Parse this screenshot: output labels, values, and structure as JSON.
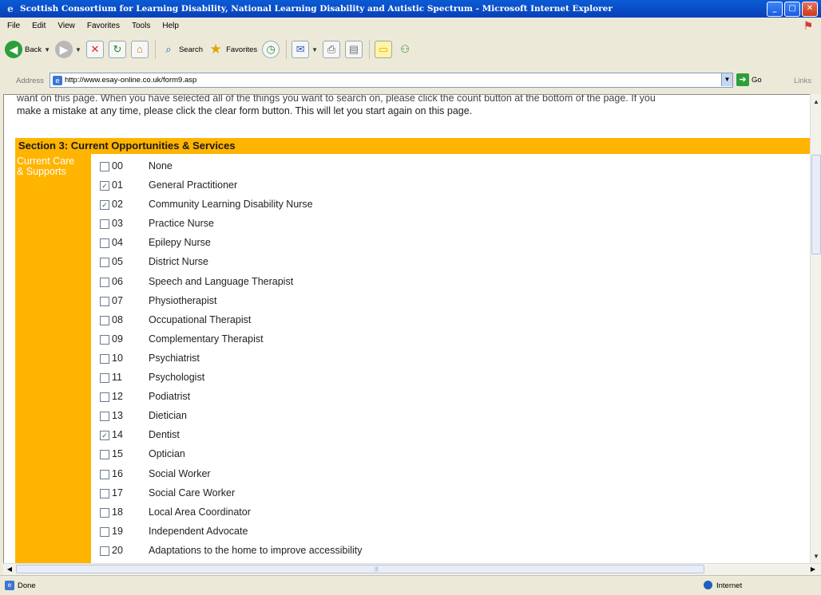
{
  "window": {
    "title": "Scottish Consortium for Learning Disability, National Learning Disability and Autistic Spectrum - Microsoft Internet Explorer"
  },
  "menu": [
    "File",
    "Edit",
    "View",
    "Favorites",
    "Tools",
    "Help"
  ],
  "toolbar": {
    "back_label": "Back",
    "search_label": "Search",
    "favorites_label": "Favorites"
  },
  "address": {
    "label": "Address",
    "url": "http://www.esay-online.co.uk/form9.asp",
    "go_label": "Go",
    "links_label": "Links"
  },
  "page": {
    "intro_line1": "want on this page. When you have selected all of the things you want to search on, please click the count button at the bottom of the page. If you",
    "intro_line2": "make a mistake at any time, please click the clear form button. This will let you start again on this page.",
    "section_title": "Section 3: Current Opportunities & Services",
    "category_line1": "Current Care",
    "category_line2": "& Supports",
    "options": [
      {
        "code": "00",
        "label": "None",
        "checked": false
      },
      {
        "code": "01",
        "label": "General Practitioner",
        "checked": true
      },
      {
        "code": "02",
        "label": "Community Learning Disability Nurse",
        "checked": true
      },
      {
        "code": "03",
        "label": "Practice Nurse",
        "checked": false
      },
      {
        "code": "04",
        "label": "Epilepy Nurse",
        "checked": false
      },
      {
        "code": "05",
        "label": "District Nurse",
        "checked": false
      },
      {
        "code": "06",
        "label": "Speech and Language Therapist",
        "checked": false
      },
      {
        "code": "07",
        "label": "Physiotherapist",
        "checked": false
      },
      {
        "code": "08",
        "label": "Occupational Therapist",
        "checked": false
      },
      {
        "code": "09",
        "label": "Complementary Therapist",
        "checked": false
      },
      {
        "code": "10",
        "label": "Psychiatrist",
        "checked": false
      },
      {
        "code": "11",
        "label": "Psychologist",
        "checked": false
      },
      {
        "code": "12",
        "label": "Podiatrist",
        "checked": false
      },
      {
        "code": "13",
        "label": "Dietician",
        "checked": false
      },
      {
        "code": "14",
        "label": "Dentist",
        "checked": true
      },
      {
        "code": "15",
        "label": "Optician",
        "checked": false
      },
      {
        "code": "16",
        "label": "Social Worker",
        "checked": false
      },
      {
        "code": "17",
        "label": "Social Care Worker",
        "checked": false
      },
      {
        "code": "18",
        "label": "Local Area Coordinator",
        "checked": false
      },
      {
        "code": "19",
        "label": "Independent Advocate",
        "checked": false
      },
      {
        "code": "20",
        "label": "Adaptations to the home to improve accessibility",
        "checked": false
      }
    ]
  },
  "status": {
    "text": "Done",
    "zone": "Internet"
  },
  "colors": {
    "section_bg": "#ffb400",
    "titlebar": "#0a5bd6"
  }
}
